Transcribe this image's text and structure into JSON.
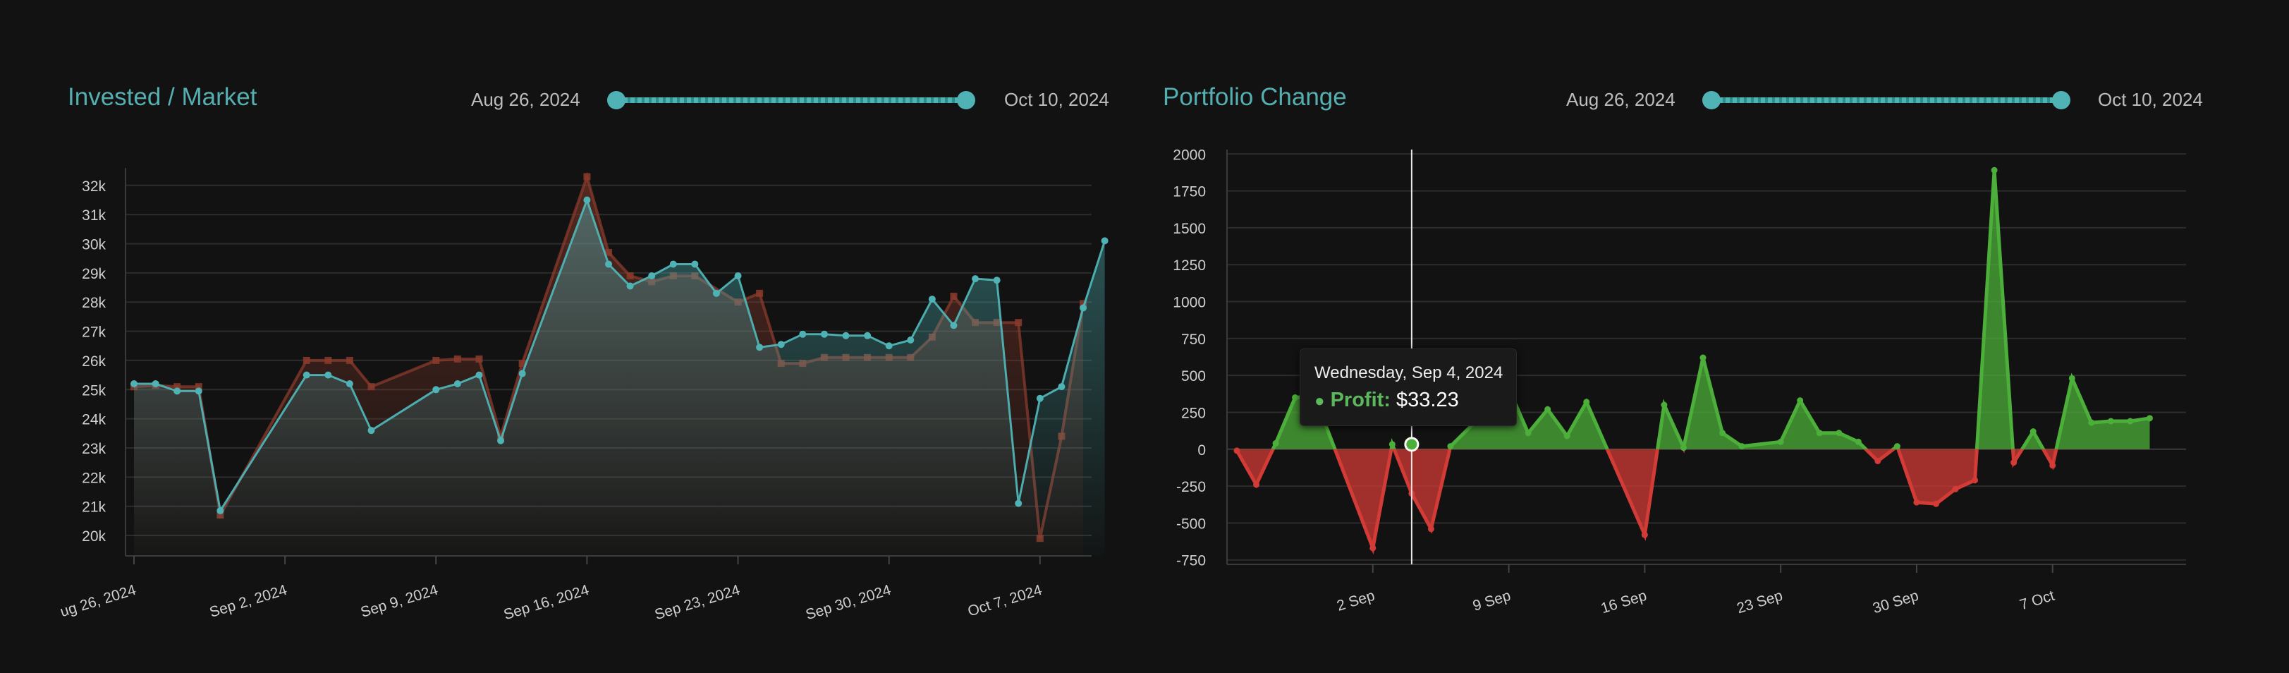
{
  "left": {
    "title": "Invested / Market",
    "range_start": "Aug 26, 2024",
    "range_end": "Oct 10, 2024"
  },
  "right": {
    "title": "Portfolio Change",
    "range_start": "Aug 26, 2024",
    "range_end": "Oct 10, 2024",
    "tooltip": {
      "date": "Wednesday, Sep 4, 2024",
      "key": "Profit:",
      "value": "$33.23"
    }
  },
  "colors": {
    "market": "#4fb3b5",
    "invested": "#8a3b2c",
    "profit": "#4caf3a",
    "loss": "#d23b36"
  },
  "chart_data": [
    {
      "type": "area",
      "title": "Invested / Market",
      "x_start": "2024-08-26",
      "xticks": [
        {
          "label": "ug 26, 2024",
          "date": "2024-08-26"
        },
        {
          "label": "Sep 2, 2024",
          "date": "2024-09-02"
        },
        {
          "label": "Sep 9, 2024",
          "date": "2024-09-09"
        },
        {
          "label": "Sep 16, 2024",
          "date": "2024-09-16"
        },
        {
          "label": "Sep 23, 2024",
          "date": "2024-09-23"
        },
        {
          "label": "Sep 30, 2024",
          "date": "2024-09-30"
        },
        {
          "label": "Oct 7, 2024",
          "date": "2024-10-07"
        }
      ],
      "yticks": [
        "20k",
        "21k",
        "22k",
        "23k",
        "24k",
        "25k",
        "26k",
        "27k",
        "28k",
        "29k",
        "30k",
        "31k",
        "32k"
      ],
      "ylim": [
        19300,
        32600
      ],
      "xlim": [
        "2024-08-26",
        "2024-10-09"
      ],
      "grid": true,
      "series": [
        {
          "color_key": "invested",
          "x": [
            "2024-08-26",
            "2024-08-27",
            "2024-08-28",
            "2024-08-29",
            "2024-08-30",
            "2024-09-03",
            "2024-09-04",
            "2024-09-05",
            "2024-09-06",
            "2024-09-09",
            "2024-09-10",
            "2024-09-11",
            "2024-09-12",
            "2024-09-13",
            "2024-09-16",
            "2024-09-17",
            "2024-09-18",
            "2024-09-19",
            "2024-09-20",
            "2024-09-21",
            "2024-09-23",
            "2024-09-24",
            "2024-09-25",
            "2024-09-26",
            "2024-09-27",
            "2024-09-28",
            "2024-09-29",
            "2024-09-30",
            "2024-10-01",
            "2024-10-02",
            "2024-10-03",
            "2024-10-04",
            "2024-10-05",
            "2024-10-06",
            "2024-10-07",
            "2024-10-08",
            "2024-10-09"
          ],
          "y": [
            25100,
            25150,
            25100,
            25100,
            20700,
            26000,
            26000,
            26000,
            25100,
            26000,
            26050,
            26050,
            23400,
            25900,
            32300,
            29700,
            28900,
            28700,
            28900,
            28900,
            28000,
            28300,
            25900,
            25900,
            26100,
            26100,
            26100,
            26100,
            26100,
            26800,
            28200,
            27300,
            27300,
            27300,
            19900,
            23400,
            27950
          ]
        },
        {
          "color_key": "market",
          "x": [
            "2024-08-26",
            "2024-08-27",
            "2024-08-28",
            "2024-08-29",
            "2024-08-30",
            "2024-09-03",
            "2024-09-04",
            "2024-09-05",
            "2024-09-06",
            "2024-09-09",
            "2024-09-10",
            "2024-09-11",
            "2024-09-12",
            "2024-09-13",
            "2024-09-16",
            "2024-09-17",
            "2024-09-18",
            "2024-09-19",
            "2024-09-20",
            "2024-09-21",
            "2024-09-22",
            "2024-09-23",
            "2024-09-24",
            "2024-09-25",
            "2024-09-26",
            "2024-09-27",
            "2024-09-28",
            "2024-09-29",
            "2024-09-30",
            "2024-10-01",
            "2024-10-02",
            "2024-10-03",
            "2024-10-04",
            "2024-10-05",
            "2024-10-06",
            "2024-10-07",
            "2024-10-08",
            "2024-10-09",
            "2024-10-10"
          ],
          "y": [
            25200,
            25200,
            24950,
            24950,
            20850,
            25500,
            25500,
            25200,
            23600,
            25000,
            25200,
            25500,
            23250,
            25550,
            31500,
            29300,
            28550,
            28900,
            29300,
            29300,
            28300,
            28900,
            26450,
            26550,
            26900,
            26900,
            26850,
            26850,
            26500,
            26700,
            28100,
            27200,
            28800,
            28750,
            21100,
            24700,
            25100,
            27800,
            30100
          ]
        }
      ]
    },
    {
      "type": "area",
      "title": "Portfolio Change",
      "x_start": "2024-08-26",
      "xticks": [
        {
          "label": "2 Sep",
          "date": "2024-09-02"
        },
        {
          "label": "9 Sep",
          "date": "2024-09-09"
        },
        {
          "label": "16 Sep",
          "date": "2024-09-16"
        },
        {
          "label": "23 Sep",
          "date": "2024-09-23"
        },
        {
          "label": "30 Sep",
          "date": "2024-09-30"
        },
        {
          "label": "7 Oct",
          "date": "2024-10-07"
        }
      ],
      "yticks": [
        "-750",
        "-500",
        "-250",
        "0",
        "250",
        "500",
        "750",
        "1000",
        "1250",
        "1500",
        "1750",
        "2000"
      ],
      "ylim": [
        -780,
        2030
      ],
      "xlim": [
        "2024-08-26",
        "2024-10-13"
      ],
      "grid": true,
      "series": [
        {
          "name": "Profit",
          "x": [
            "2024-08-26",
            "2024-08-27",
            "2024-08-28",
            "2024-08-29",
            "2024-08-30",
            "2024-09-02",
            "2024-09-03",
            "2024-09-04",
            "2024-09-05",
            "2024-09-06",
            "2024-09-09",
            "2024-09-10",
            "2024-09-11",
            "2024-09-12",
            "2024-09-13",
            "2024-09-16",
            "2024-09-17",
            "2024-09-18",
            "2024-09-19",
            "2024-09-20",
            "2024-09-21",
            "2024-09-23",
            "2024-09-24",
            "2024-09-25",
            "2024-09-26",
            "2024-09-27",
            "2024-09-28",
            "2024-09-29",
            "2024-09-30",
            "2024-10-01",
            "2024-10-02",
            "2024-10-03",
            "2024-10-04",
            "2024-10-05",
            "2024-10-06",
            "2024-10-07",
            "2024-10-08",
            "2024-10-09",
            "2024-10-10",
            "2024-10-11",
            "2024-10-12"
          ],
          "y": [
            -10,
            -240,
            40,
            350,
            360,
            -670,
            33.23,
            -300,
            -540,
            20,
            410,
            110,
            270,
            90,
            320,
            -580,
            300,
            10,
            620,
            110,
            20,
            50,
            330,
            110,
            110,
            50,
            -80,
            20,
            -360,
            -370,
            -270,
            -210,
            1890,
            -90,
            120,
            -110,
            480,
            180,
            190,
            190,
            210
          ]
        }
      ],
      "tooltip": {
        "date": "Wednesday, Sep 4, 2024",
        "series": "Profit",
        "value": "$33.23"
      }
    }
  ]
}
